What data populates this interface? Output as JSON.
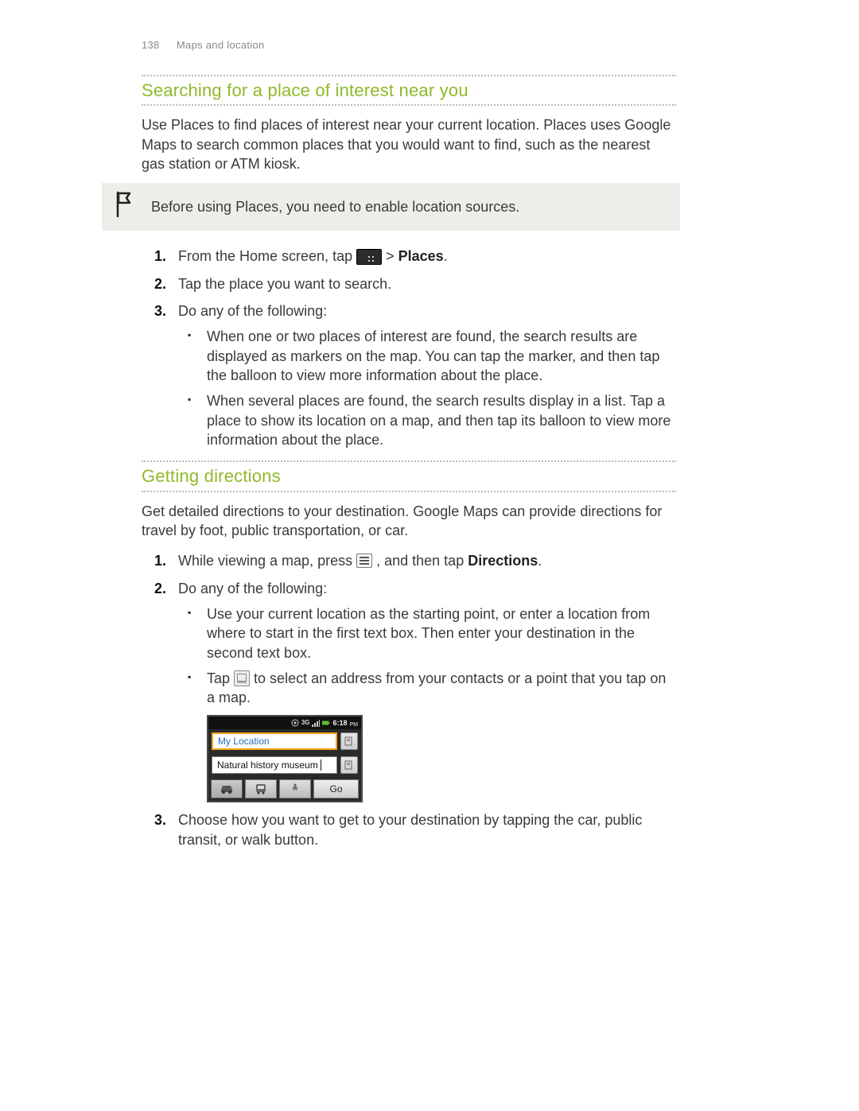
{
  "header": {
    "page_number": "138",
    "section": "Maps and location"
  },
  "section1": {
    "title": "Searching for a place of interest near you",
    "intro": "Use Places to find places of interest near your current location. Places uses Google Maps to search common places that you would want to find, such as the nearest gas station or ATM kiosk.",
    "note": "Before using Places, you need to enable location sources.",
    "steps": {
      "s1_a": "From the Home screen, tap ",
      "s1_b": " > ",
      "s1_c": "Places",
      "s1_d": ".",
      "s2": "Tap the place you want to search.",
      "s3": "Do any of the following:",
      "b1": "When one or two places of interest are found, the search results are displayed as markers on the map. You can tap the marker, and then tap the balloon to view more information about the place.",
      "b2": "When several places are found, the search results display in a list. Tap a place to show its location on a map, and then tap its balloon to view more information about the place."
    }
  },
  "section2": {
    "title": "Getting directions",
    "intro": "Get detailed directions to your destination. Google Maps can provide directions for travel by foot, public transportation, or car.",
    "steps": {
      "s1_a": "While viewing a map, press ",
      "s1_b": ", and then tap ",
      "s1_c": "Directions",
      "s1_d": ".",
      "s2": "Do any of the following:",
      "b1": "Use your current location as the starting point, or enter a location from where to start in the first text box. Then enter your destination in the second text box.",
      "b2_a": "Tap ",
      "b2_b": " to select an address from your contacts or a point that you tap on a map.",
      "s3": "Choose how you want to get to your destination by tapping the car, public transit, or walk button."
    }
  },
  "phone": {
    "time": "6:18",
    "time_suffix": "PM",
    "net": "3G",
    "start_field": "My Location",
    "end_field": "Natural history museum",
    "go": "Go"
  }
}
